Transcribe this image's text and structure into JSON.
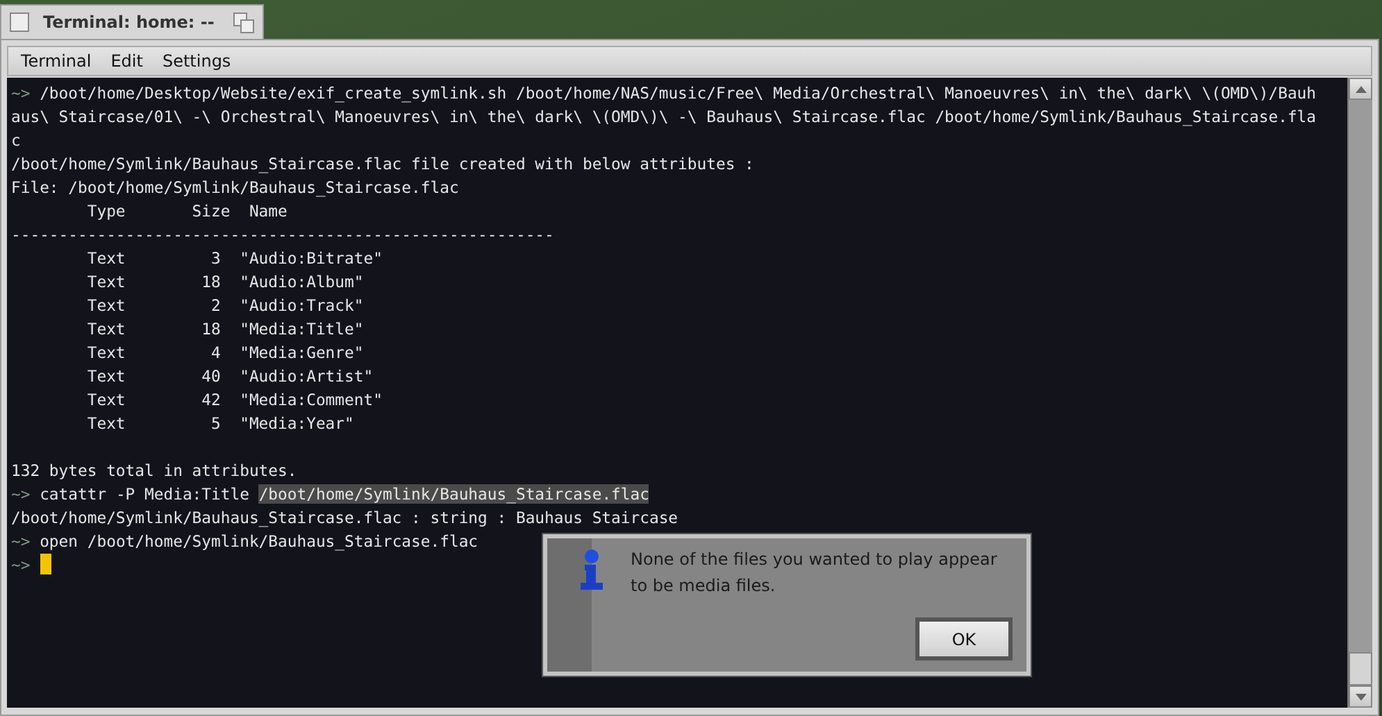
{
  "window": {
    "title": "Terminal: home: --"
  },
  "menu": [
    "Terminal",
    "Edit",
    "Settings"
  ],
  "terminal": {
    "lines": [
      {
        "kind": "command",
        "prompt": "~>",
        "text": "/boot/home/Desktop/Website/exif_create_symlink.sh /boot/home/NAS/music/Free\\ Media/Orchestral\\ Manoeuvres\\ in\\ the\\ dark\\ \\(OMD\\)/Bauh"
      },
      {
        "kind": "output",
        "text": "aus\\ Staircase/01\\ -\\ Orchestral\\ Manoeuvres\\ in\\ the\\ dark\\ \\(OMD\\)\\ -\\ Bauhaus\\ Staircase.flac /boot/home/Symlink/Bauhaus_Staircase.fla"
      },
      {
        "kind": "output",
        "text": "c"
      },
      {
        "kind": "output",
        "text": "/boot/home/Symlink/Bauhaus_Staircase.flac file created with below attributes :"
      },
      {
        "kind": "output",
        "text": "File: /boot/home/Symlink/Bauhaus_Staircase.flac"
      },
      {
        "kind": "output",
        "text": "        Type       Size  Name"
      },
      {
        "kind": "output",
        "text": "---------------------------------------------------------"
      },
      {
        "kind": "output",
        "text": "        Text         3  \"Audio:Bitrate\""
      },
      {
        "kind": "output",
        "text": "        Text        18  \"Audio:Album\""
      },
      {
        "kind": "output",
        "text": "        Text         2  \"Audio:Track\""
      },
      {
        "kind": "output",
        "text": "        Text        18  \"Media:Title\""
      },
      {
        "kind": "output",
        "text": "        Text         4  \"Media:Genre\""
      },
      {
        "kind": "output",
        "text": "        Text        40  \"Audio:Artist\""
      },
      {
        "kind": "output",
        "text": "        Text        42  \"Media:Comment\""
      },
      {
        "kind": "output",
        "text": "        Text         5  \"Media:Year\""
      },
      {
        "kind": "blank"
      },
      {
        "kind": "output",
        "text": "132 bytes total in attributes."
      },
      {
        "kind": "command",
        "prompt": "~>",
        "text": "catattr -P Media:Title",
        "selection": "/boot/home/Symlink/Bauhaus_Staircase.flac"
      },
      {
        "kind": "output",
        "text": "/boot/home/Symlink/Bauhaus_Staircase.flac : string : Bauhaus Staircase"
      },
      {
        "kind": "command",
        "prompt": "~>",
        "text": "open /boot/home/Symlink/Bauhaus_Staircase.flac"
      },
      {
        "kind": "command",
        "prompt": "~>",
        "cursor": true
      }
    ]
  },
  "dialog": {
    "message": "None of the files you wanted to play appear to be media files.",
    "buttons": [
      "OK"
    ]
  }
}
